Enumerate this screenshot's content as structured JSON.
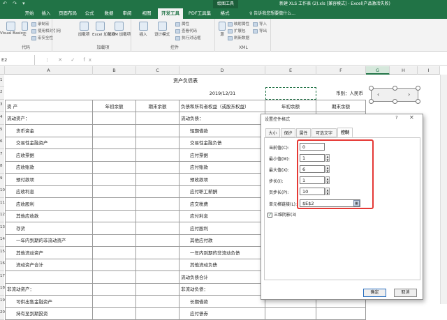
{
  "titlebar": {
    "context_label": "绘图工具",
    "document_title": "新建 XLS 工作表 (2).xls [兼容模式] - Excel(产品激活失败)",
    "quick_access": "↶ ↷ ▾"
  },
  "tabs": [
    "开始",
    "插入",
    "页面布局",
    "公式",
    "数据",
    "审阅",
    "视图",
    "开发工具",
    "PDF工具集",
    "格式"
  ],
  "active_tab": "开发工具",
  "tell_me": "♀ 告诉我您想要做什么...",
  "ribbon": {
    "code": {
      "label": "代码",
      "visual_basic": "Visual Basic",
      "macro": "宏",
      "record_macro": "录制宏",
      "relative_ref": "使用相对引用",
      "macro_security": "宏安全性"
    },
    "addins": {
      "label": "加载项",
      "addins": "加载项",
      "excel_addins": "Excel 加载项",
      "com_addins": "COM 加载项"
    },
    "controls": {
      "label": "控件",
      "insert": "插入",
      "design_mode": "设计模式",
      "properties": "属性",
      "view_code": "查看代码",
      "run_dialog": "执行对话框"
    },
    "xml": {
      "label": "XML",
      "source": "源",
      "map_props": "映射属性",
      "expansion": "扩展包",
      "refresh": "刷新数据",
      "import": "导入",
      "export": "导出"
    }
  },
  "formula_bar": {
    "name_box": "E2",
    "icons": "⋮ ✕ ✓ fx",
    "value": ""
  },
  "columns": [
    "A",
    "B",
    "C",
    "D",
    "E",
    "F",
    "G",
    "H",
    "I"
  ],
  "selected_column": "G",
  "rows": [
    "1",
    "2",
    "3",
    "4",
    "5",
    "6",
    "7",
    "8",
    "9",
    "10",
    "11",
    "12",
    "13",
    "14",
    "15",
    "16",
    "17",
    "18",
    "19",
    "20"
  ],
  "sheet": {
    "title": "资产负债表",
    "date": "2019/12/31",
    "currency": "币别：人民币",
    "header": [
      "资      产",
      "年初余额",
      "期末余额",
      "负债和所有者权益（或股东权益）",
      "年初余额",
      "期末余额"
    ],
    "left_items": [
      "流动资产：",
      "货币资金",
      "交易性金融资产",
      "应收票据",
      "应收账款",
      "预付款项",
      "应收利息",
      "应收股利",
      "其他应收款",
      "存货",
      "一年内到期的非流动资产",
      "其他流动资产",
      "流动资产合计",
      "",
      "非流动资产：",
      "可供出售金融资产",
      "持有至到期投资"
    ],
    "right_items": [
      "流动负债：",
      "短期借款",
      "交易性金融负债",
      "应付票据",
      "应付账款",
      "预收款项",
      "应付职工薪酬",
      "应交税费",
      "应付利息",
      "应付股利",
      "其他应付款",
      "一年内到期的非流动负债",
      "其他流动负债",
      "流动负债合计",
      "非流动负债：",
      "长期借款",
      "应付债券"
    ]
  },
  "dialog": {
    "title": "设置控件格式",
    "tabs": [
      "大小",
      "保护",
      "属性",
      "可选文字",
      "控制"
    ],
    "active_tab": "控制",
    "current_value_label": "当前值(C):",
    "current_value": "0",
    "min_label": "最小值(M):",
    "min_value": "1",
    "max_label": "最大值(X):",
    "max_value": "6",
    "step_label": "步长(I):",
    "step_value": "1",
    "page_step_label": "页步长(P):",
    "page_step_value": "10",
    "cell_link_label": "单元格链接(L):",
    "cell_link_value": "$E$2",
    "shading_label": "三维阴影(3)",
    "ok_label": "确定",
    "cancel_label": "取消",
    "help_icon": "?",
    "close_icon": "✕"
  },
  "colors": {
    "excel_green": "#217346",
    "highlight_red": "#e53935"
  }
}
